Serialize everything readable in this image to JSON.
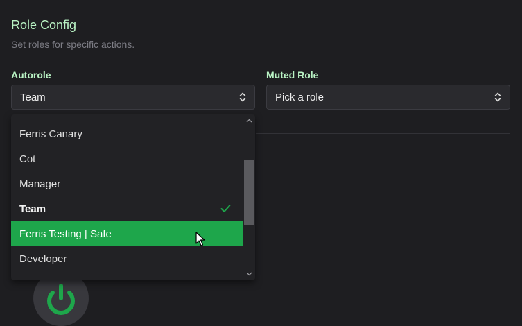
{
  "header": {
    "title": "Role Config",
    "subtitle": "Set roles for specific actions."
  },
  "autorole": {
    "label": "Autorole",
    "value": "Team"
  },
  "muted_role": {
    "label": "Muted Role",
    "placeholder": "Pick a role"
  },
  "dropdown": {
    "options": [
      {
        "label": "Ferris Canary"
      },
      {
        "label": "Cot"
      },
      {
        "label": "Manager"
      },
      {
        "label": "Team",
        "selected": true
      },
      {
        "label": "Ferris Testing | Safe",
        "hovered": true
      },
      {
        "label": "Developer"
      }
    ]
  },
  "colors": {
    "accent": "#1ea64b",
    "heading": "#b9f3c4",
    "background": "#1e1e21"
  },
  "icons": [
    "chevron-updown-icon",
    "checkmark-icon",
    "power-icon",
    "arrow-cursor-icon"
  ]
}
